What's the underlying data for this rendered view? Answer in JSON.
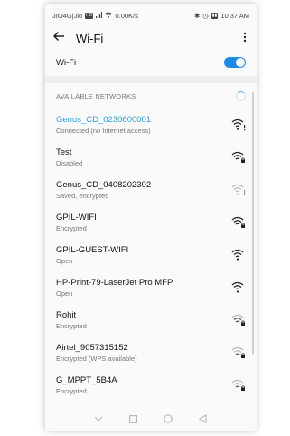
{
  "status_bar": {
    "carrier": "JIO4G|Jio",
    "speed": "0.00K/s",
    "time": "10:37 AM"
  },
  "header": {
    "title": "Wi-Fi",
    "back_icon": "arrow-back-icon",
    "more_icon": "more-vert-icon"
  },
  "wifi_toggle": {
    "label": "Wi-Fi",
    "state": "on"
  },
  "section": {
    "title": "AVAILABLE NETWORKS"
  },
  "networks": [
    {
      "name": "Genus_CD_0230600001",
      "status": "Connected (no Internet access)",
      "connected": true
    },
    {
      "name": "Test",
      "status": "Disabled"
    },
    {
      "name": "Genus_CD_0408202302",
      "status": "Saved, encrypted"
    },
    {
      "name": "GPIL-WIFI",
      "status": "Encrypted"
    },
    {
      "name": "GPIL-GUEST-WIFI",
      "status": "Open"
    },
    {
      "name": "HP-Print-79-LaserJet Pro MFP",
      "status": "Open"
    },
    {
      "name": "Rohit",
      "status": "Encrypted"
    },
    {
      "name": "Airtel_9057315152",
      "status": "Encrypted (WPS available)"
    },
    {
      "name": "G_MPPT_5B4A",
      "status": "Encrypted"
    }
  ],
  "colors": {
    "accent": "#1e88e5",
    "connected_text": "#29a1d4"
  }
}
